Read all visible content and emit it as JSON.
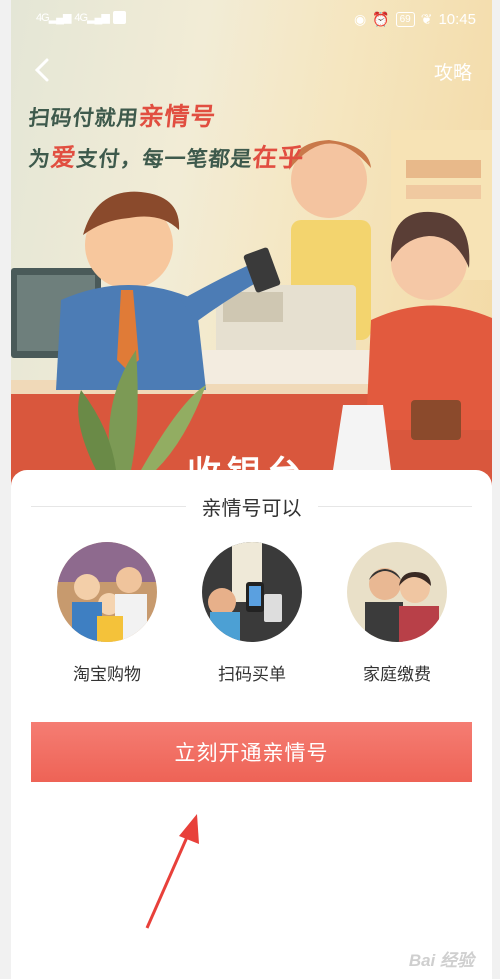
{
  "status_bar": {
    "signal_1": "4G",
    "signal_2": "4G",
    "battery": "69",
    "time": "10:45"
  },
  "nav": {
    "back_icon": "chevron-left-icon",
    "guide_label": "攻略"
  },
  "hero": {
    "slogan_line1_a": "扫码付就用",
    "slogan_line1_b": "亲情号",
    "slogan_line2_a": "为",
    "slogan_line2_b": "爱",
    "slogan_line2_c": "支付，每一笔都是",
    "slogan_line2_d": "在乎",
    "counter_sign": "收银台"
  },
  "card": {
    "section_title": "亲情号可以",
    "features": [
      {
        "label": "淘宝购物",
        "icon": "family-shopping-photo"
      },
      {
        "label": "扫码买单",
        "icon": "scan-pay-photo"
      },
      {
        "label": "家庭缴费",
        "icon": "elderly-couple-photo"
      }
    ],
    "open_button_label": "立刻开通亲情号"
  },
  "watermark": "Bai 经验",
  "colors": {
    "button_top": "#f57d73",
    "button_bottom": "#ee6356",
    "slogan_green": "#3e5a4c",
    "slogan_red": "#e14e40",
    "arrow": "#e8403a"
  }
}
